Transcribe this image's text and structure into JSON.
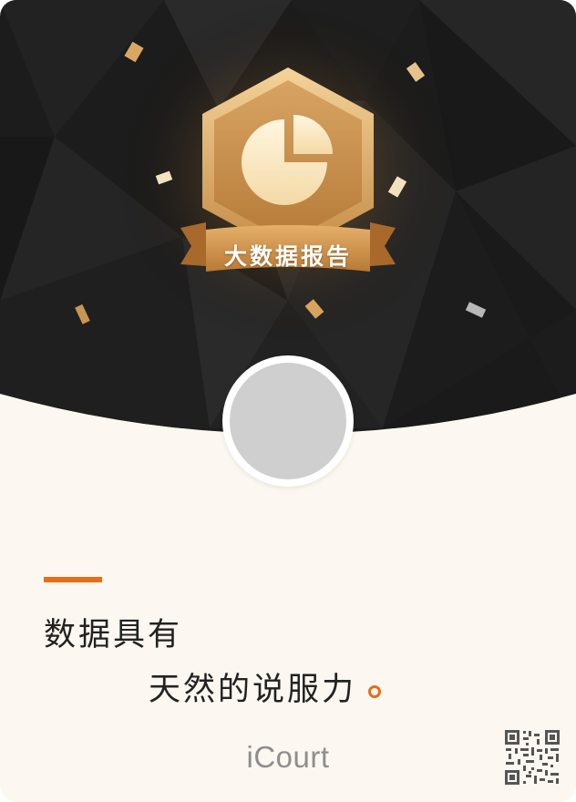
{
  "badge": {
    "label": "大数据报告",
    "icon": "pie-chart-icon"
  },
  "avatar": {
    "kind": "avatar-placeholder"
  },
  "slogan": {
    "line1": "数据具有",
    "line2": "天然的说服力"
  },
  "footer": {
    "brand": "iCourt",
    "qr_icon": "qr-code-icon"
  },
  "colors": {
    "hero_background": "#1b1b1b",
    "card_background": "#fcf8f1",
    "accent": "#e86d14",
    "badge_gold": "#d9a15c",
    "text": "#222222",
    "brand_text": "#8e8e8e"
  }
}
